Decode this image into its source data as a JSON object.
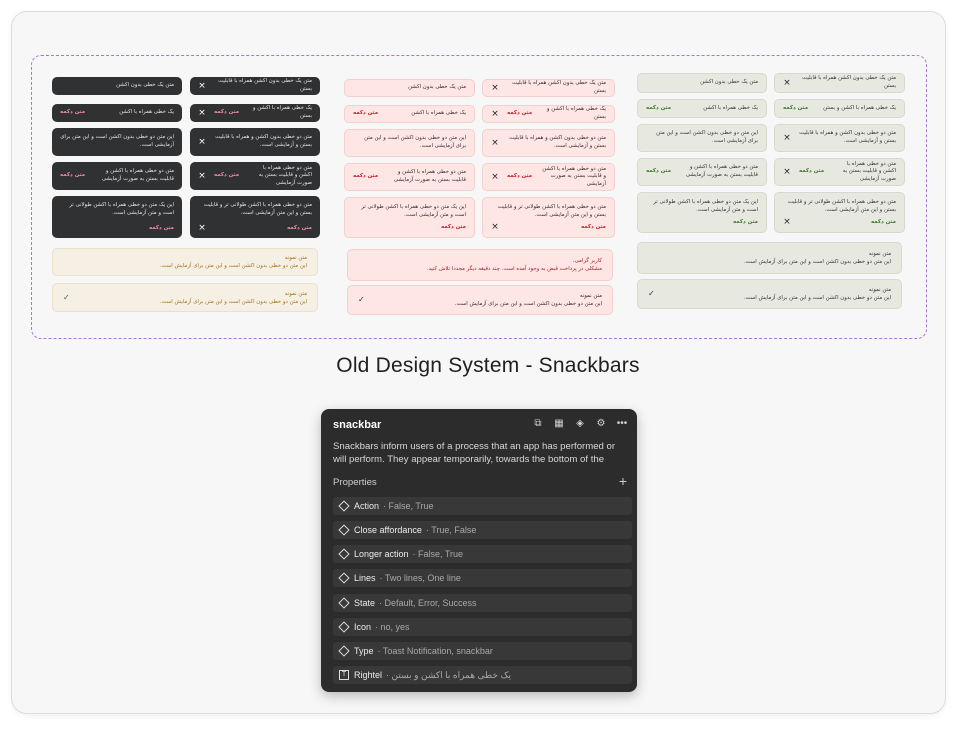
{
  "caption": "Old Design System - Snackbars",
  "colors": {
    "dark": "#2f3133",
    "pink": "#fde6e4",
    "green": "#e7e9e0",
    "beige": "#f5efe4",
    "panel": "#2c2c2c",
    "accent_dashed": "#a877d6"
  },
  "snackbars": {
    "one_line_no_action": "متن یک خطی بدون اکشن",
    "one_line_close": "متن یک خطی بدون اکشن همراه با قابلیت بستن",
    "one_line_close_alt": "متن یک خطی بدون اکشن همراه با قابلیت بستن",
    "button_text": "متن دکمه",
    "one_line_action": "یک خطی همراه با اکشن",
    "one_line_action_close": "یک خطی همراه با اکشن و بستن",
    "two_line_no_action": "این متن دو خطی بدون اکشن است و این متن برای آزمایشی است.",
    "two_line_close": "متن دو خطی بدون اکشن و همراه با قابلیت بستن و آزمایشی است.",
    "two_line_action": "متن دو خطی همراه با اکشن و قابلیت بستن به صورت آزمایشی",
    "two_line_action_close": "متن دو خطی همراه با اکشن و قابلیت بستن به صورت آزمایشی",
    "long_action": "این یک متن دو خطی همراه با اکشن طولانی تر است و متن آزمایشی است.",
    "long_action_close": "متن دو خطی همراه با اکشن طولانی تر و قابلیت بستن و این متن آزمایشی است."
  },
  "toasts": {
    "sample_title": "متن نمونه",
    "sample_body": "این متن دو خطی بدون اکشن است و این متن برای آزمایش است.",
    "error_title": "کاربر گرامی،",
    "error_body": "مشکلی در پرداخت قبض به وجود آمده است. چند دقیقه دیگر مجددا تلاش کنید."
  },
  "panel": {
    "title": "snackbar",
    "description": "Snackbars inform users of a process that an app has performed or will perform. They appear temporarily, towards the bottom of the screen. The…",
    "properties_label": "Properties",
    "icons": [
      "copy-icon",
      "grid-icon",
      "component-icon",
      "settings-icon",
      "more-icon"
    ],
    "properties": [
      {
        "name": "Action",
        "value": "False, True",
        "kind": "variant"
      },
      {
        "name": "Close affordance",
        "value": "True, False",
        "kind": "variant"
      },
      {
        "name": "Longer action",
        "value": "False, True",
        "kind": "variant"
      },
      {
        "name": "Lines",
        "value": "Two lines, One line",
        "kind": "variant"
      },
      {
        "name": "State",
        "value": "Default, Error, Success",
        "kind": "variant"
      },
      {
        "name": "Icon",
        "value": "no, yes",
        "kind": "variant"
      },
      {
        "name": "Type",
        "value": "Toast Notification, snackbar",
        "kind": "variant"
      },
      {
        "name": "Rightel",
        "value": "یک خطی همراه با اکشن و بستن",
        "kind": "text"
      }
    ]
  }
}
